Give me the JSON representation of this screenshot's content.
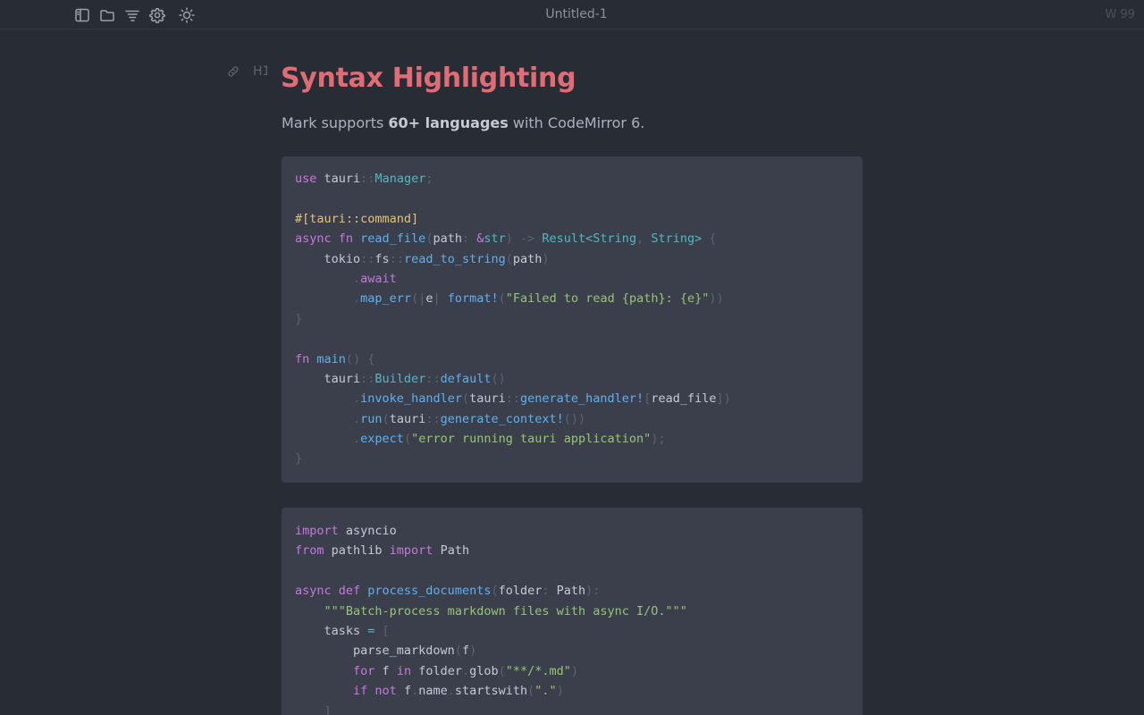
{
  "app": {
    "doc_title": "Untitled-1",
    "word_count": "W 99"
  },
  "toolbar_icons": [
    "sidebar-icon",
    "folder-icon",
    "outline-icon",
    "gear-icon",
    "sun-icon"
  ],
  "gutter": {
    "heading_marker": "H1"
  },
  "document": {
    "heading": "Syntax Highlighting",
    "paragraph": {
      "before": "Mark supports ",
      "bold": "60+ languages",
      "after": " with CodeMirror 6."
    }
  },
  "code_blocks": [
    {
      "language": "rust",
      "lines": [
        [
          [
            "k",
            "use"
          ],
          [
            "v",
            " tauri"
          ],
          [
            "p",
            "::"
          ],
          [
            "t",
            "Manager"
          ],
          [
            "p",
            ";"
          ]
        ],
        [],
        [
          [
            "a",
            "#[tauri::command]"
          ]
        ],
        [
          [
            "k",
            "async fn "
          ],
          [
            "f",
            "read_file"
          ],
          [
            "p",
            "("
          ],
          [
            "v",
            "path"
          ],
          [
            "p",
            ": "
          ],
          [
            "k",
            "&"
          ],
          [
            "t",
            "str"
          ],
          [
            "p",
            ") -> "
          ],
          [
            "t",
            "Result<String"
          ],
          [
            "p",
            ", "
          ],
          [
            "t",
            "String>"
          ],
          [
            "p",
            " {"
          ]
        ],
        [
          [
            "v",
            "    tokio"
          ],
          [
            "p",
            "::"
          ],
          [
            "v",
            "fs"
          ],
          [
            "p",
            "::"
          ],
          [
            "f",
            "read_to_string"
          ],
          [
            "p",
            "("
          ],
          [
            "v",
            "path"
          ],
          [
            "p",
            ")"
          ]
        ],
        [
          [
            "v",
            "        "
          ],
          [
            "p",
            "."
          ],
          [
            "k",
            "await"
          ]
        ],
        [
          [
            "v",
            "        "
          ],
          [
            "p",
            "."
          ],
          [
            "f",
            "map_err"
          ],
          [
            "p",
            "(|"
          ],
          [
            "v",
            "e"
          ],
          [
            "p",
            "| "
          ],
          [
            "f",
            "format!"
          ],
          [
            "p",
            "("
          ],
          [
            "s",
            "\"Failed to read {path}: {e}\""
          ],
          [
            "p",
            "))"
          ]
        ],
        [
          [
            "p",
            "}"
          ]
        ],
        [],
        [
          [
            "k",
            "fn "
          ],
          [
            "f",
            "main"
          ],
          [
            "p",
            "() {"
          ]
        ],
        [
          [
            "v",
            "    tauri"
          ],
          [
            "p",
            "::"
          ],
          [
            "t",
            "Builder"
          ],
          [
            "p",
            "::"
          ],
          [
            "f",
            "default"
          ],
          [
            "p",
            "()"
          ]
        ],
        [
          [
            "v",
            "        "
          ],
          [
            "p",
            "."
          ],
          [
            "f",
            "invoke_handler"
          ],
          [
            "p",
            "("
          ],
          [
            "v",
            "tauri"
          ],
          [
            "p",
            "::"
          ],
          [
            "f",
            "generate_handler!"
          ],
          [
            "p",
            "["
          ],
          [
            "v",
            "read_file"
          ],
          [
            "p",
            "])"
          ]
        ],
        [
          [
            "v",
            "        "
          ],
          [
            "p",
            "."
          ],
          [
            "f",
            "run"
          ],
          [
            "p",
            "("
          ],
          [
            "v",
            "tauri"
          ],
          [
            "p",
            "::"
          ],
          [
            "f",
            "generate_context!"
          ],
          [
            "p",
            "())"
          ]
        ],
        [
          [
            "v",
            "        "
          ],
          [
            "p",
            "."
          ],
          [
            "f",
            "expect"
          ],
          [
            "p",
            "("
          ],
          [
            "s",
            "\"error running tauri application\""
          ],
          [
            "p",
            ");"
          ]
        ],
        [
          [
            "p",
            "}"
          ]
        ]
      ]
    },
    {
      "language": "python",
      "lines": [
        [
          [
            "k",
            "import"
          ],
          [
            "v",
            " asyncio"
          ]
        ],
        [
          [
            "k",
            "from"
          ],
          [
            "v",
            " pathlib "
          ],
          [
            "k",
            "import"
          ],
          [
            "v",
            " Path"
          ]
        ],
        [],
        [
          [
            "k",
            "async def "
          ],
          [
            "f",
            "process_documents"
          ],
          [
            "p",
            "("
          ],
          [
            "v",
            "folder"
          ],
          [
            "p",
            ": "
          ],
          [
            "v",
            "Path"
          ],
          [
            "p",
            "):"
          ]
        ],
        [
          [
            "v",
            "    "
          ],
          [
            "s",
            "\"\"\"Batch-process markdown files with async I/O.\"\"\""
          ]
        ],
        [
          [
            "v",
            "    tasks "
          ],
          [
            "t",
            "="
          ],
          [
            "p",
            " ["
          ]
        ],
        [
          [
            "v",
            "        parse_markdown"
          ],
          [
            "p",
            "("
          ],
          [
            "v",
            "f"
          ],
          [
            "p",
            ")"
          ]
        ],
        [
          [
            "v",
            "        "
          ],
          [
            "k",
            "for"
          ],
          [
            "v",
            " f "
          ],
          [
            "k",
            "in"
          ],
          [
            "v",
            " folder"
          ],
          [
            "p",
            "."
          ],
          [
            "v",
            "glob"
          ],
          [
            "p",
            "("
          ],
          [
            "s",
            "\"**/*.md\""
          ],
          [
            "p",
            ")"
          ]
        ],
        [
          [
            "v",
            "        "
          ],
          [
            "k",
            "if not"
          ],
          [
            "v",
            " f"
          ],
          [
            "p",
            "."
          ],
          [
            "v",
            "name"
          ],
          [
            "p",
            "."
          ],
          [
            "v",
            "startswith"
          ],
          [
            "p",
            "("
          ],
          [
            "s",
            "\".\""
          ],
          [
            "p",
            ")"
          ]
        ],
        [
          [
            "p",
            "    ]"
          ]
        ]
      ]
    }
  ]
}
